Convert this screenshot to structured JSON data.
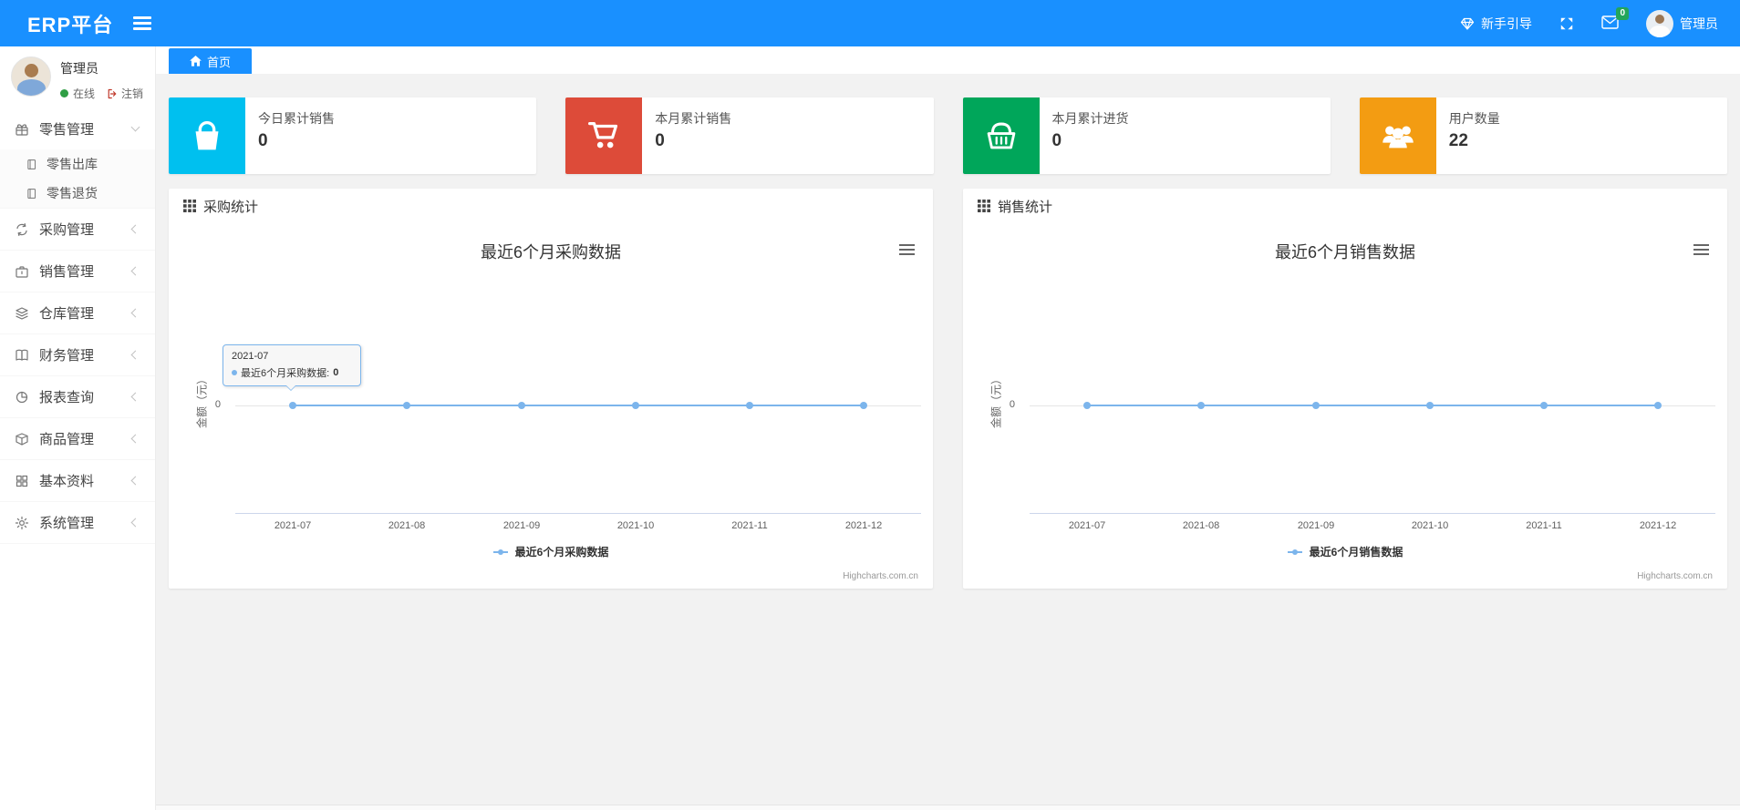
{
  "app_title": "ERP平台",
  "header": {
    "guide_label": "新手引导",
    "mail_badge": "0",
    "username": "管理员",
    "colors": {
      "header_bg": "#1990ff",
      "badge_green": "#23a55a"
    }
  },
  "sidebar": {
    "user": {
      "name": "管理员",
      "status_online": "在线",
      "logout_label": "注销"
    },
    "menu": [
      {
        "label": "零售管理",
        "icon": "gift-icon",
        "expanded": true,
        "children": [
          {
            "label": "零售出库",
            "icon": "notebook-icon"
          },
          {
            "label": "零售退货",
            "icon": "notebook-icon"
          }
        ]
      },
      {
        "label": "采购管理",
        "icon": "repeat-icon"
      },
      {
        "label": "销售管理",
        "icon": "briefcase-icon"
      },
      {
        "label": "仓库管理",
        "icon": "layers-icon"
      },
      {
        "label": "财务管理",
        "icon": "book-icon"
      },
      {
        "label": "报表查询",
        "icon": "pie-chart-icon"
      },
      {
        "label": "商品管理",
        "icon": "box-icon"
      },
      {
        "label": "基本资料",
        "icon": "grid-icon"
      },
      {
        "label": "系统管理",
        "icon": "gear-icon"
      }
    ]
  },
  "tabbar": {
    "home_label": "首页"
  },
  "cards": [
    {
      "label": "今日累计销售",
      "value": "0",
      "color": "#00c0ef",
      "icon": "shopping-bag-icon"
    },
    {
      "label": "本月累计销售",
      "value": "0",
      "color": "#dd4b39",
      "icon": "cart-icon"
    },
    {
      "label": "本月累计进货",
      "value": "0",
      "color": "#00a65a",
      "icon": "basket-icon"
    },
    {
      "label": "用户数量",
      "value": "22",
      "color": "#f39c12",
      "icon": "users-icon"
    }
  ],
  "panels": [
    {
      "title": "采购统计"
    },
    {
      "title": "销售统计"
    }
  ],
  "chart_data": [
    {
      "type": "line",
      "title": "最近6个月采购数据",
      "categories": [
        "2021-07",
        "2021-08",
        "2021-09",
        "2021-10",
        "2021-11",
        "2021-12"
      ],
      "series": [
        {
          "name": "最近6个月采购数据",
          "values": [
            0,
            0,
            0,
            0,
            0,
            0
          ]
        }
      ],
      "xlabel": "",
      "ylabel": "金额（元）",
      "yticks": [
        "0"
      ],
      "line_color": "#7cb5ec",
      "grid": false,
      "legend_position": "bottom",
      "credits": "Highcharts.com.cn",
      "tooltip": {
        "x": "2021-07",
        "label": "最近6个月采购数据:",
        "value": "0"
      }
    },
    {
      "type": "line",
      "title": "最近6个月销售数据",
      "categories": [
        "2021-07",
        "2021-08",
        "2021-09",
        "2021-10",
        "2021-11",
        "2021-12"
      ],
      "series": [
        {
          "name": "最近6个月销售数据",
          "values": [
            0,
            0,
            0,
            0,
            0,
            0
          ]
        }
      ],
      "xlabel": "",
      "ylabel": "金额（元）",
      "yticks": [
        "0"
      ],
      "line_color": "#7cb5ec",
      "grid": false,
      "legend_position": "bottom",
      "credits": "Highcharts.com.cn"
    }
  ]
}
